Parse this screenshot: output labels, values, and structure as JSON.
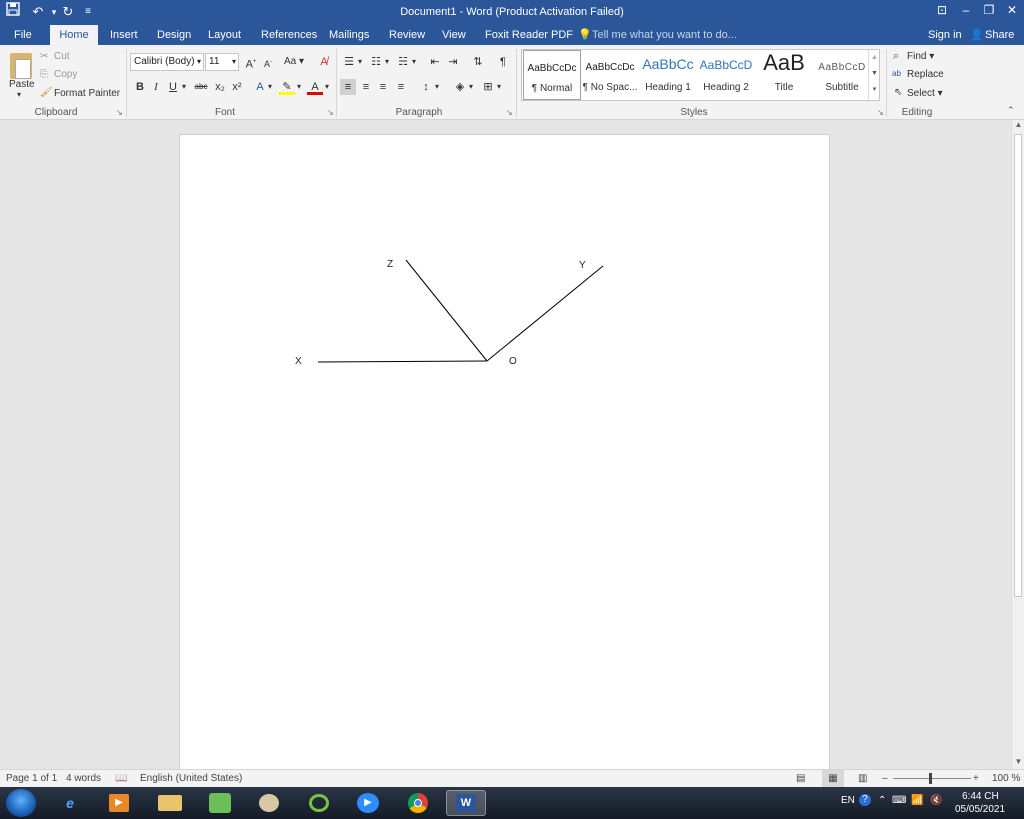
{
  "window": {
    "title": "Document1 - Word (Product Activation Failed)",
    "qat": {
      "save_icon": "save-icon",
      "undo_icon": "undo-icon",
      "redo_icon": "redo-icon",
      "customize_icon": "customize-qat-icon"
    },
    "controls": {
      "restore_ribbon": "ribbon-display-icon",
      "minimize": "minimize-icon",
      "maximize": "restore-icon",
      "close": "close-icon"
    }
  },
  "tabs": [
    "File",
    "Home",
    "Insert",
    "Design",
    "Layout",
    "References",
    "Mailings",
    "Review",
    "View",
    "Foxit Reader PDF"
  ],
  "active_tab": "Home",
  "tell_me": "Tell me what you want to do...",
  "sign_in": "Sign in",
  "share": "Share",
  "clipboard": {
    "paste": "Paste",
    "cut": "Cut",
    "copy": "Copy",
    "format_painter": "Format Painter",
    "label": "Clipboard"
  },
  "font": {
    "name": "Calibri (Body)",
    "size": "11",
    "case": "Aa",
    "label": "Font",
    "buttons": [
      "B",
      "I",
      "U",
      "abc",
      "x₂",
      "x²"
    ]
  },
  "paragraph": {
    "label": "Paragraph"
  },
  "styles": {
    "label": "Styles",
    "items": [
      {
        "preview": "AaBbCcDc",
        "name": "¶ Normal",
        "color": "#000000"
      },
      {
        "preview": "AaBbCcDc",
        "name": "¶ No Spac...",
        "color": "#000000"
      },
      {
        "preview": "AaBbCc",
        "name": "Heading 1",
        "color": "#2e74b5"
      },
      {
        "preview": "AaBbCcD",
        "name": "Heading 2",
        "color": "#2e74b5"
      },
      {
        "preview": "AaB",
        "name": "Title",
        "color": "#000000"
      },
      {
        "preview": "AaBbCcD",
        "name": "Subtitle",
        "color": "#595959"
      }
    ]
  },
  "editing": {
    "label": "Editing",
    "find": "Find",
    "replace": "Replace",
    "select": "Select"
  },
  "document": {
    "labels": {
      "z": "Z",
      "y": "Y",
      "x": "X",
      "o": "O"
    }
  },
  "status": {
    "page": "Page 1 of 1",
    "words": "4 words",
    "language": "English (United States)",
    "zoom": "100 %"
  },
  "taskbar": {
    "lang": "EN",
    "time": "6:44 CH",
    "date": "05/05/2021"
  },
  "colors": {
    "accent": "#2b579a",
    "ribbon_bg": "#f3f3f3"
  }
}
